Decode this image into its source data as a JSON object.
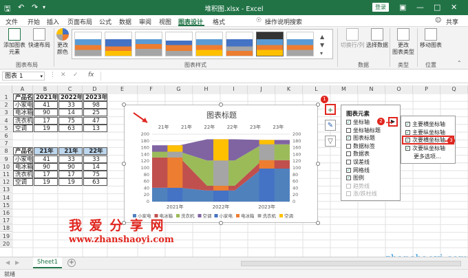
{
  "titlebar": {
    "doc_title": "堆积图.xlsx - Excel",
    "login": "登录"
  },
  "menu": {
    "items": [
      "文件",
      "开始",
      "插入",
      "页面布局",
      "公式",
      "数据",
      "审阅",
      "视图",
      "图表设计",
      "格式"
    ],
    "active": "图表设计",
    "search": "操作说明搜索",
    "share": "共享"
  },
  "ribbon": {
    "add_element": "添加图表\n元素",
    "quick_layout": "快速布局",
    "change_color": "更改\n颜色",
    "switch_row_col": "切换行/列",
    "select_data": "选择数据",
    "change_chart_type": "更改\n图表类型",
    "move_chart": "移动图表",
    "groups": {
      "layouts": "图表布局",
      "styles": "图表样式",
      "data": "数据",
      "type": "类型",
      "location": "位置"
    }
  },
  "formula": {
    "name_box": "图表 1",
    "fx": "fx"
  },
  "columns": [
    "A",
    "B",
    "C",
    "D",
    "E",
    "F",
    "G",
    "H",
    "I",
    "J",
    "K",
    "L",
    "M",
    "N",
    "O",
    "P",
    "Q"
  ],
  "rows": [
    "1",
    "2",
    "3",
    "4",
    "5",
    "6",
    "7",
    "8",
    "9",
    "10",
    "11",
    "12",
    "13",
    "14",
    "15",
    "16",
    "17",
    "18",
    "19",
    "20"
  ],
  "table1": {
    "header": [
      "产品名称",
      "2021年",
      "2022年",
      "2023年"
    ],
    "rows": [
      [
        "小家电",
        "41",
        "33",
        "98"
      ],
      [
        "电冰箱",
        "90",
        "14",
        "25"
      ],
      [
        "洗衣机",
        "17",
        "75",
        "47"
      ],
      [
        "空调",
        "19",
        "63",
        "13"
      ]
    ]
  },
  "table2": {
    "header": [
      "产品名称",
      "21年",
      "21年",
      "22年"
    ],
    "rows": [
      [
        "小家电",
        "41",
        "33",
        "33"
      ],
      [
        "电冰箱",
        "90",
        "90",
        "14"
      ],
      [
        "洗衣机",
        "17",
        "17",
        "75"
      ],
      [
        "空调",
        "19",
        "19",
        "63"
      ]
    ]
  },
  "chart_data": {
    "type": "area",
    "title": "图表标题",
    "top_axis_labels": [
      "21年",
      "21年",
      "22年",
      "22年",
      "23年",
      "23年"
    ],
    "bottom_axis_labels": [
      "2021年",
      "2022年",
      "2023年"
    ],
    "y_ticks": [
      "200",
      "180",
      "160",
      "140",
      "120",
      "100",
      "80",
      "60",
      "40",
      "20",
      "0"
    ],
    "ylim": [
      0,
      200
    ],
    "series": [
      {
        "name": "小家电",
        "values": [
          41,
          41,
          33,
          33,
          98,
          98
        ],
        "color": "#4472c4"
      },
      {
        "name": "电冰箱",
        "values": [
          90,
          90,
          14,
          14,
          25,
          25
        ],
        "color": "#ed7d31"
      },
      {
        "name": "洗衣机",
        "values": [
          17,
          17,
          75,
          75,
          47,
          47
        ],
        "color": "#a5a5a5"
      },
      {
        "name": "空调",
        "values": [
          19,
          19,
          63,
          63,
          13,
          13
        ],
        "color": "#ffc000"
      }
    ],
    "area_series": [
      {
        "name": "小家电",
        "color": "#4f81bd"
      },
      {
        "name": "电冰箱",
        "color": "#c0504d"
      },
      {
        "name": "洗衣机",
        "color": "#9bbb59"
      },
      {
        "name": "空调",
        "color": "#8064a2"
      }
    ],
    "legend_position": "bottom"
  },
  "chart_elements_panel": {
    "title": "图表元素",
    "items": [
      {
        "label": "坐标轴",
        "checked": true,
        "enabled": true
      },
      {
        "label": "坐标轴标题",
        "checked": false,
        "enabled": true
      },
      {
        "label": "图表标题",
        "checked": true,
        "enabled": true
      },
      {
        "label": "数据标签",
        "checked": false,
        "enabled": true
      },
      {
        "label": "数据表",
        "checked": false,
        "enabled": true
      },
      {
        "label": "误差线",
        "checked": false,
        "enabled": true
      },
      {
        "label": "网格线",
        "checked": true,
        "enabled": true
      },
      {
        "label": "图例",
        "checked": true,
        "enabled": true
      },
      {
        "label": "趋势线",
        "checked": false,
        "enabled": false
      },
      {
        "label": "涨/跌柱线",
        "checked": false,
        "enabled": false
      }
    ]
  },
  "axes_submenu": {
    "items": [
      {
        "label": "主要横坐标轴",
        "checked": true
      },
      {
        "label": "主要纵坐标轴",
        "checked": true
      },
      {
        "label": "次要横坐标轴",
        "checked": true
      },
      {
        "label": "次要纵坐标轴",
        "checked": true
      }
    ],
    "more": "更多选项..."
  },
  "markers": [
    "1",
    "2",
    "3"
  ],
  "watermark": {
    "brand": "我 爱 分 享 网",
    "url": "www.zhanshaoyi.com",
    "corner": "zhanshaoyi.com"
  },
  "sheet": {
    "tab": "Sheet1",
    "add": "+"
  },
  "status": {
    "ready": "就绪"
  }
}
